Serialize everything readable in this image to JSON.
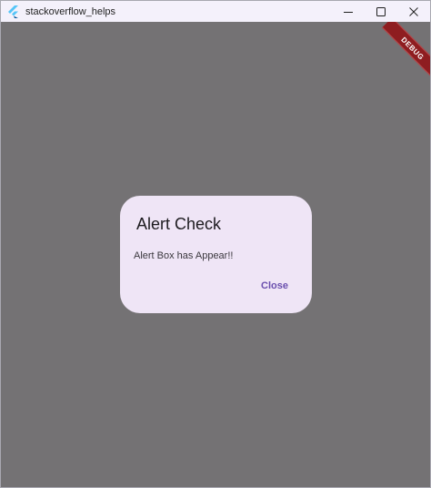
{
  "window": {
    "title": "stackoverflow_helps"
  },
  "banner": {
    "label": "DEBUG"
  },
  "dialog": {
    "title": "Alert Check",
    "message": "Alert Box has Appear!!",
    "close_label": "Close"
  },
  "colors": {
    "scrim": "#747274",
    "dialog_bg": "#efe5f6",
    "accent": "#6a4fae",
    "banner": "#8e1d20"
  },
  "icons": {
    "app": "flutter-logo-icon",
    "minimize": "minimize-icon",
    "maximize": "maximize-icon",
    "close": "close-icon"
  }
}
